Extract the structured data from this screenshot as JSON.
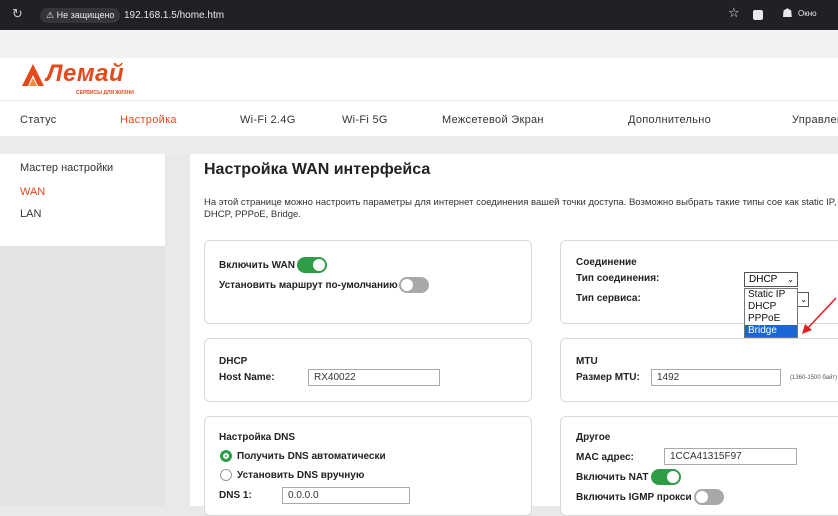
{
  "browser": {
    "reload_icon": "reload-icon",
    "security_label": "Не защищено",
    "url": "192.168.1.5/home.htm",
    "profile_label": "Окно"
  },
  "brand": {
    "name": "Лемай",
    "tagline": "СЕРВИСЫ ДЛЯ ЖИЗНИ",
    "color": "#e24a1c"
  },
  "nav": {
    "items": [
      "Статус",
      "Настройка",
      "Wi-Fi 2.4G",
      "Wi-Fi 5G",
      "Межсетевой Экран",
      "Дополнительно",
      "Управлен"
    ]
  },
  "sidebar": {
    "items": [
      "Мастер настройки",
      "WAN",
      "LAN"
    ]
  },
  "page": {
    "title": "Настройка WAN интерфейса",
    "description": "На этой странице можно настроить параметры для интернет соединения вашей точки доступа. Возможно выбрать такие типы сое как static IP, DHCP, PPPoE, Bridge."
  },
  "wan_card": {
    "enable_wan": "Включить WAN",
    "default_route": "Установить маршрут по-умолчанию"
  },
  "connection_card": {
    "heading": "Соединение",
    "type_label": "Тип соединения:",
    "type_value": "DHCP",
    "service_label": "Тип сервиса:",
    "options": [
      "Static IP",
      "DHCP",
      "PPPoE",
      "Bridge"
    ],
    "highlighted_option": "Bridge"
  },
  "dhcp_card": {
    "heading": "DHCP",
    "host_label": "Host Name:",
    "host_value": "RX40022"
  },
  "mtu_card": {
    "heading": "MTU",
    "size_label": "Размер MTU:",
    "size_value": "1492",
    "hint": "(1360-1500 байт)"
  },
  "dns_card": {
    "heading": "Настройка DNS",
    "auto": "Получить DNS автоматически",
    "manual": "Установить DNS вручную",
    "dns1_label": "DNS 1:",
    "dns1_value": "0.0.0.0"
  },
  "other_card": {
    "heading": "Другое",
    "mac_label": "MAC адрес:",
    "mac_value": "1CCA41315F97",
    "nat_label": "Включить NAT",
    "igmp_label": "Включить IGMP прокси"
  },
  "colors": {
    "toggle_on": "#2e9e46",
    "toggle_off": "#a8a8a8",
    "selection": "#1967d2"
  }
}
